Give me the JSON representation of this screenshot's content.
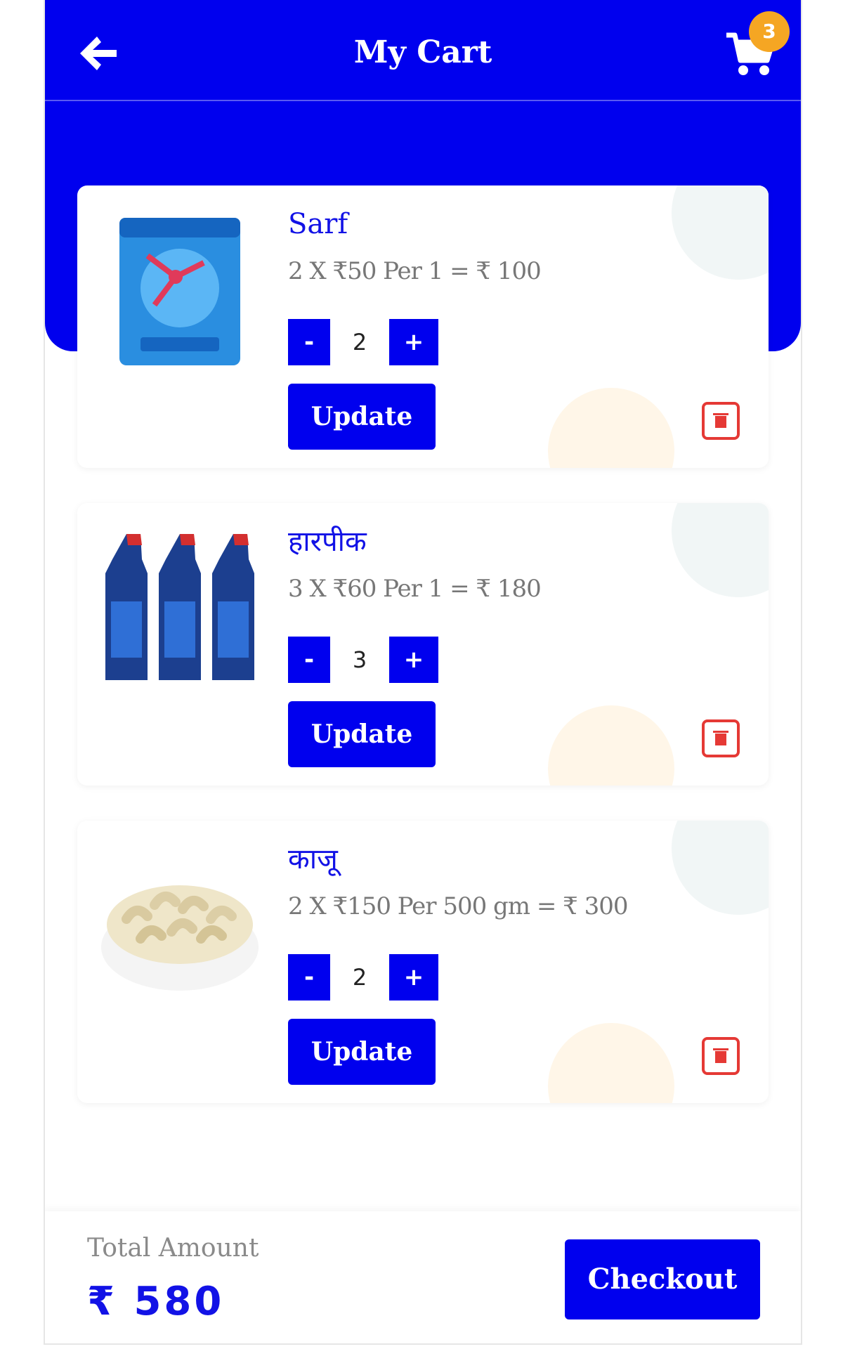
{
  "header": {
    "title": "My Cart",
    "cart_count": "3",
    "back_icon": "arrow-left-icon",
    "cart_icon": "shopping-cart-icon"
  },
  "cart": {
    "items": [
      {
        "name": "Sarf",
        "price_line": "2 X ₹50 Per 1 = ₹ 100",
        "quantity": "2",
        "minus_label": "-",
        "plus_label": "+",
        "update_label": "Update",
        "delete_icon": "delete-icon"
      },
      {
        "name": "हारपीक",
        "price_line": "3 X ₹60 Per 1 = ₹ 180",
        "quantity": "3",
        "minus_label": "-",
        "plus_label": "+",
        "update_label": "Update",
        "delete_icon": "delete-icon"
      },
      {
        "name": "काजू",
        "price_line": "2 X ₹150 Per 500 gm = ₹ 300",
        "quantity": "2",
        "minus_label": "-",
        "plus_label": "+",
        "update_label": "Update",
        "delete_icon": "delete-icon"
      }
    ]
  },
  "footer": {
    "total_label": "Total Amount",
    "total_value": "₹ 580",
    "checkout_label": "Checkout"
  },
  "colors": {
    "primary": "#0000ee",
    "badge": "#f5a623",
    "delete": "#e53935",
    "text_muted": "#777777"
  }
}
